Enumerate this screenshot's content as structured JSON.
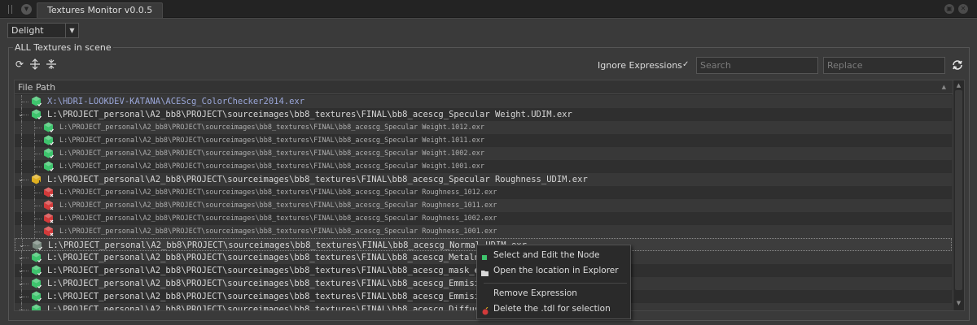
{
  "app": {
    "tab_title": "Textures Monitor v0.0.5"
  },
  "toolbar": {
    "context_value": "Delight",
    "group_title": "ALL Textures in scene",
    "ignore_expressions_label": "Ignore Expressions",
    "ignore_expressions_checked": true,
    "checkmark": "✓",
    "search_placeholder": "Search",
    "replace_placeholder": "Replace"
  },
  "tree": {
    "column_header": "File Path",
    "rows": [
      {
        "path": "X:\\HDRI-LOOKDEV-KATANA\\ACEScg_ColorChecker2014.exr",
        "level": 0,
        "status": "ok",
        "expandable": false
      },
      {
        "path": "L:\\PROJECT_personal\\A2_bb8\\PROJECT\\sourceimages\\bb8_textures\\FINAL\\bb8_acescg_Specular Weight.UDIM.exr",
        "level": 0,
        "status": "ok",
        "expandable": true
      },
      {
        "path": "L:\\PROJECT_personal\\A2_bb8\\PROJECT\\sourceimages\\bb8_textures\\FINAL\\bb8_acescg_Specular Weight.1012.exr",
        "level": 1,
        "status": "ok"
      },
      {
        "path": "L:\\PROJECT_personal\\A2_bb8\\PROJECT\\sourceimages\\bb8_textures\\FINAL\\bb8_acescg_Specular Weight.1011.exr",
        "level": 1,
        "status": "ok"
      },
      {
        "path": "L:\\PROJECT_personal\\A2_bb8\\PROJECT\\sourceimages\\bb8_textures\\FINAL\\bb8_acescg_Specular Weight.1002.exr",
        "level": 1,
        "status": "ok"
      },
      {
        "path": "L:\\PROJECT_personal\\A2_bb8\\PROJECT\\sourceimages\\bb8_textures\\FINAL\\bb8_acescg_Specular Weight.1001.exr",
        "level": 1,
        "status": "ok"
      },
      {
        "path": "L:\\PROJECT_personal\\A2_bb8\\PROJECT\\sourceimages\\bb8_textures\\FINAL\\bb8_acescg_Specular Roughness_UDIM.exr",
        "level": 0,
        "status": "warning",
        "expandable": true
      },
      {
        "path": "L:\\PROJECT_personal\\A2_bb8\\PROJECT\\sourceimages\\bb8_textures\\FINAL\\bb8_acescg_Specular Roughness_1012.exr",
        "level": 1,
        "status": "error"
      },
      {
        "path": "L:\\PROJECT_personal\\A2_bb8\\PROJECT\\sourceimages\\bb8_textures\\FINAL\\bb8_acescg_Specular Roughness_1011.exr",
        "level": 1,
        "status": "error"
      },
      {
        "path": "L:\\PROJECT_personal\\A2_bb8\\PROJECT\\sourceimages\\bb8_textures\\FINAL\\bb8_acescg_Specular Roughness_1002.exr",
        "level": 1,
        "status": "error"
      },
      {
        "path": "L:\\PROJECT_personal\\A2_bb8\\PROJECT\\sourceimages\\bb8_textures\\FINAL\\bb8_acescg_Specular Roughness_1001.exr",
        "level": 1,
        "status": "error"
      },
      {
        "path": "L:\\PROJECT_personal\\A2_bb8\\PROJECT\\sourceimages\\bb8_textures\\FINAL\\bb8_acescg_Normal_UDIM.exr",
        "level": 0,
        "status": "ok",
        "expandable": true,
        "selected": true
      },
      {
        "path": "L:\\PROJECT_personal\\A2_bb8\\PROJECT\\sourceimages\\bb8_textures\\FINAL\\bb8_acescg_Metalness_",
        "level": 0,
        "status": "ok",
        "expandable": true
      },
      {
        "path": "L:\\PROJECT_personal\\A2_bb8\\PROJECT\\sourceimages\\bb8_textures\\FINAL\\bb8_acescg_mask_eyes_",
        "level": 0,
        "status": "ok",
        "expandable": true
      },
      {
        "path": "L:\\PROJECT_personal\\A2_bb8\\PROJECT\\sourceimages\\bb8_textures\\FINAL\\bb8_acescg_Emmisive_w",
        "level": 0,
        "status": "ok",
        "expandable": true
      },
      {
        "path": "L:\\PROJECT_personal\\A2_bb8\\PROJECT\\sourceimages\\bb8_textures\\FINAL\\bb8_acescg_Emmisive_c",
        "level": 0,
        "status": "ok",
        "expandable": true
      },
      {
        "path": "L:\\PROJECT_personal\\A2_bb8\\PROJECT\\sourceimages\\bb8_textures\\FINAL\\bb8_acescg_Diffuse_Co",
        "level": 0,
        "status": "ok",
        "expandable": true
      }
    ]
  },
  "context_menu": {
    "items": [
      {
        "label": "Select and Edit the Node",
        "icon": "green-square-icon"
      },
      {
        "label": "Open the location in Explorer",
        "icon": "folder-icon"
      },
      {
        "label": "Remove Expression",
        "icon": ""
      },
      {
        "label": "Delete the .tdl for selection",
        "icon": "red-bomb-icon"
      }
    ]
  },
  "colors": {
    "ok": "#3ec46d",
    "warning": "#e0b020",
    "error": "#d23a3a",
    "selected_hex": "#7a8a80"
  }
}
